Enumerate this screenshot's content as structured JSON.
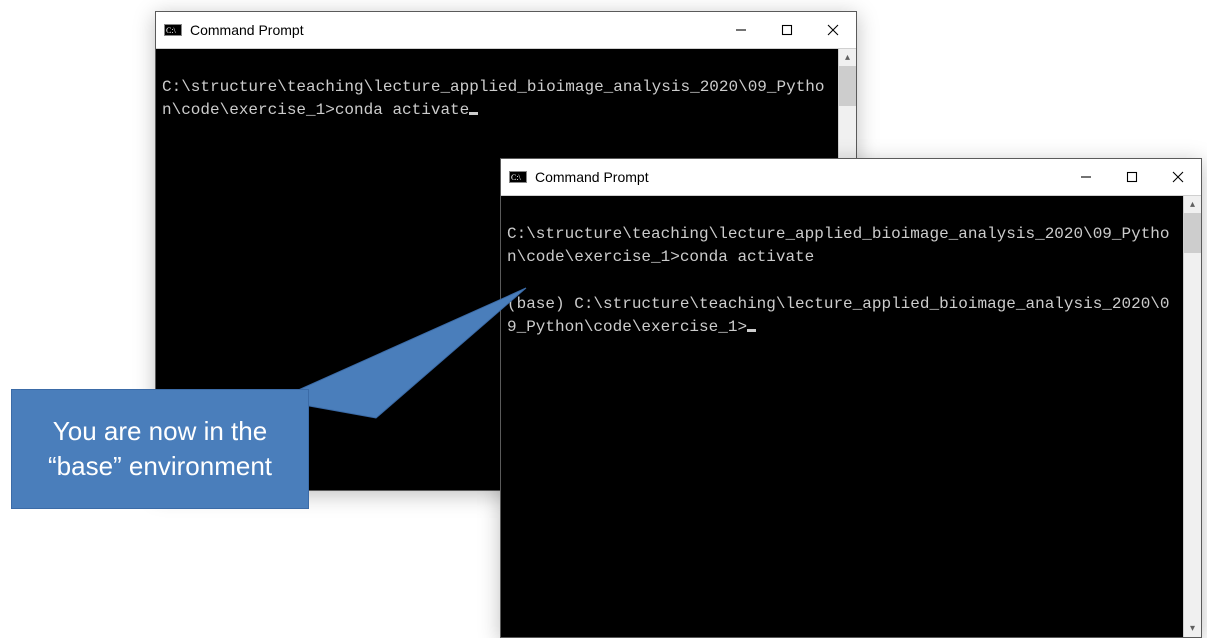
{
  "window1": {
    "title": "Command Prompt",
    "terminal_text": "\nC:\\structure\\teaching\\lecture_applied_bioimage_analysis_2020\\09_Python\\code\\exercise_1>conda activate"
  },
  "window2": {
    "title": "Command Prompt",
    "terminal_text": "\nC:\\structure\\teaching\\lecture_applied_bioimage_analysis_2020\\09_Python\\code\\exercise_1>conda activate\n\n(base) C:\\structure\\teaching\\lecture_applied_bioimage_analysis_2020\\09_Python\\code\\exercise_1>"
  },
  "callout": {
    "text": "You are now in the “base” environment"
  },
  "icons": {
    "scroll_up": "▴",
    "scroll_down": "▾"
  }
}
